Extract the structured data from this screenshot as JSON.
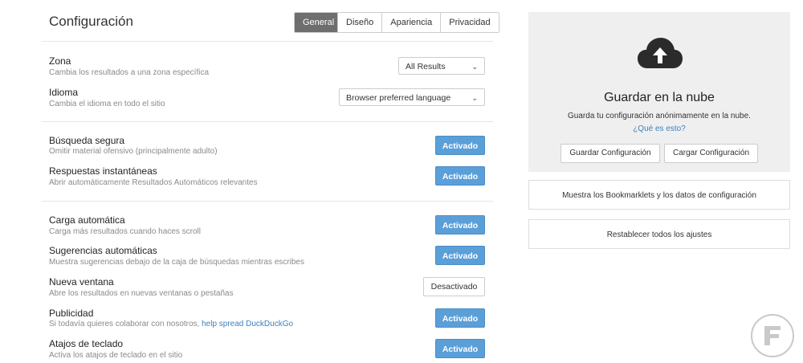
{
  "header": {
    "title": "Configuración",
    "tabs": [
      {
        "label": "General",
        "active": true
      },
      {
        "label": "Diseño",
        "active": false
      },
      {
        "label": "Apariencia",
        "active": false
      },
      {
        "label": "Privacidad",
        "active": false
      }
    ]
  },
  "settings": {
    "zona": {
      "label": "Zona",
      "desc": "Cambia los resultados a una zona específica",
      "value": "All Results"
    },
    "idioma": {
      "label": "Idioma",
      "desc": "Cambia el idioma en todo el sitio",
      "value": "Browser preferred language"
    },
    "busqueda_segura": {
      "label": "Búsqueda segura",
      "desc": "Omitir material ofensivo (principalmente adulto)",
      "button": "Activado"
    },
    "respuestas": {
      "label": "Respuestas instantáneas",
      "desc": "Abrir automáticamente Resultados Automáticos relevantes",
      "button": "Activado"
    },
    "carga": {
      "label": "Carga automática",
      "desc": "Carga más resultados cuando haces scroll",
      "button": "Activado"
    },
    "sugerencias": {
      "label": "Sugerencias automáticas",
      "desc": "Muestra sugerencias debajo de la caja de búsquedas mientras escribes",
      "button": "Activado"
    },
    "nueva_ventana": {
      "label": "Nueva ventana",
      "desc": "Abre los resultados en nuevas ventanas o pestañas",
      "button": "Desactivado"
    },
    "publicidad": {
      "label": "Publicidad",
      "desc": "Si todavía quieres colaborar con nosotros, ",
      "link": "help spread DuckDuckGo",
      "button": "Activado"
    },
    "atajos": {
      "label": "Atajos de teclado",
      "desc": "Activa los atajos de teclado en el sitio",
      "button": "Activado"
    }
  },
  "cloud": {
    "icon": "cloud-upload-icon",
    "title": "Guardar en la nube",
    "desc": "Guarda tu configuración anónimamente en la nube.",
    "link": "¿Qué es esto?",
    "save_button": "Guardar Configuración",
    "load_button": "Cargar Configuración"
  },
  "sidebar": {
    "bookmarklets": "Muestra los Bookmarklets y los datos de configuración",
    "reset": "Restablecer todos los ajustes"
  },
  "colors": {
    "accent": "#5b9fd8",
    "link": "#3b80bf",
    "active_tab": "#6e6e6e",
    "panel": "#efefef"
  }
}
